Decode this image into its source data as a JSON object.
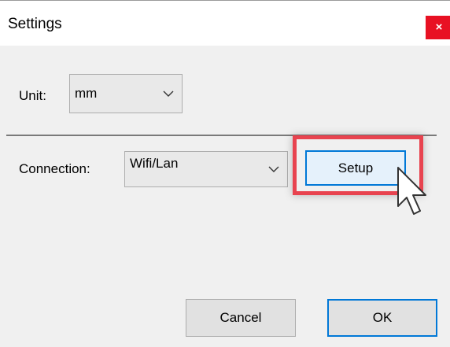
{
  "window": {
    "title": "Settings",
    "close_glyph": "×"
  },
  "unit": {
    "label": "Unit:",
    "value": "mm"
  },
  "connection": {
    "label": "Connection:",
    "value": "Wifi/Lan",
    "setup_label": "Setup"
  },
  "footer": {
    "cancel_label": "Cancel",
    "ok_label": "OK"
  },
  "colors": {
    "close_button": "#e81123",
    "highlight": "#e8434f",
    "focus_border": "#0078d7",
    "setup_fill": "#e5f1fb"
  },
  "icons": {
    "close": "close-icon",
    "dropdown": "chevron-down-icon",
    "cursor": "mouse-pointer-icon"
  }
}
